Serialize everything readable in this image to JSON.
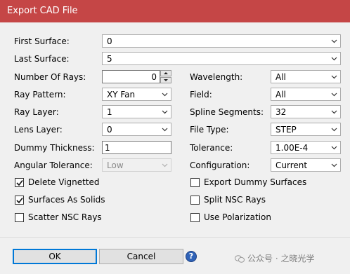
{
  "window": {
    "title": "Export CAD File"
  },
  "fields": {
    "first_surface": {
      "label": "First Surface:",
      "value": "0"
    },
    "last_surface": {
      "label": "Last Surface:",
      "value": "5"
    },
    "number_of_rays": {
      "label": "Number Of Rays:",
      "value": "0"
    },
    "ray_pattern": {
      "label": "Ray Pattern:",
      "value": "XY Fan"
    },
    "ray_layer": {
      "label": "Ray Layer:",
      "value": "1"
    },
    "lens_layer": {
      "label": "Lens Layer:",
      "value": "0"
    },
    "dummy_thickness": {
      "label": "Dummy Thickness:",
      "value": "1"
    },
    "angular_tolerance": {
      "label": "Angular Tolerance:",
      "value": "Low"
    },
    "wavelength": {
      "label": "Wavelength:",
      "value": "All"
    },
    "field": {
      "label": "Field:",
      "value": "All"
    },
    "spline_segments": {
      "label": "Spline Segments:",
      "value": "32"
    },
    "file_type": {
      "label": "File Type:",
      "value": "STEP"
    },
    "tolerance": {
      "label": "Tolerance:",
      "value": "1.00E-4"
    },
    "configuration": {
      "label": "Configuration:",
      "value": "Current"
    }
  },
  "checkboxes": {
    "delete_vignetted": {
      "label": "Delete Vignetted",
      "checked": true
    },
    "surfaces_as_solids": {
      "label": "Surfaces As Solids",
      "checked": true
    },
    "scatter_nsc_rays": {
      "label": "Scatter NSC Rays",
      "checked": false
    },
    "export_dummy_surfaces": {
      "label": "Export Dummy Surfaces",
      "checked": false
    },
    "split_nsc_rays": {
      "label": "Split NSC Rays",
      "checked": false
    },
    "use_polarization": {
      "label": "Use Polarization",
      "checked": false
    }
  },
  "buttons": {
    "ok": "OK",
    "cancel": "Cancel",
    "help": "?"
  },
  "watermark": {
    "text": "公众号 · 之晓光学"
  },
  "colors": {
    "title_bar": "#c54646",
    "dialog_bg": "#f0f0f0",
    "default_button_border": "#0078d7"
  },
  "icons": {
    "dropdown": "chevron-down-icon",
    "help": "help-icon",
    "spinner": "spinner-arrows-icon",
    "watermark": "wechat-icon"
  }
}
